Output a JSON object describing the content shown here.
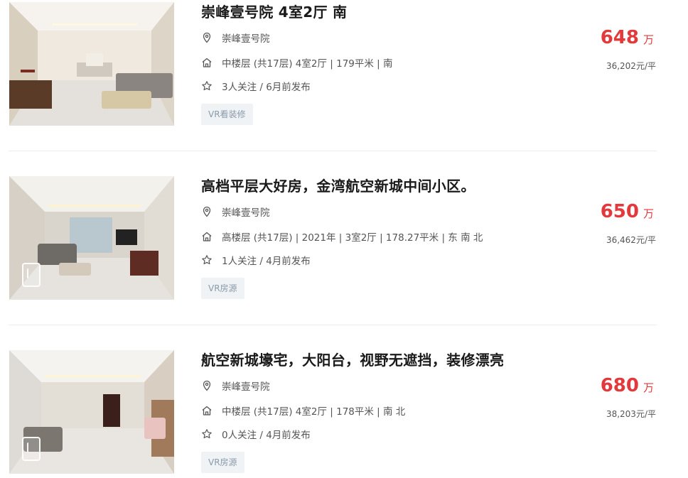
{
  "listings": [
    {
      "title": "崇峰壹号院 4室2厅 南",
      "community": "崇峰壹号院",
      "house_info": "中楼层 (共17层) 4室2厅 | 179平米 | 南",
      "follow_info": "3人关注 / 6月前发布",
      "tag": "VR看装修",
      "price": "648",
      "price_unit": "万",
      "unit_price": "36,202元/平"
    },
    {
      "title": "高档平层大好房，金湾航空新城中间小区。",
      "community": "崇峰壹号院",
      "house_info": "高楼层 (共17层) | 2021年 | 3室2厅 | 178.27平米 | 东 南 北",
      "follow_info": "1人关注 / 4月前发布",
      "tag": "VR房源",
      "price": "650",
      "price_unit": "万",
      "unit_price": "36,462元/平"
    },
    {
      "title": "航空新城壕宅，大阳台，视野无遮挡，装修漂亮",
      "community": "崇峰壹号院",
      "house_info": "中楼层 (共17层) 4室2厅 | 178平米 | 南 北",
      "follow_info": "0人关注 / 4月前发布",
      "tag": "VR房源",
      "price": "680",
      "price_unit": "万",
      "unit_price": "38,203元/平"
    }
  ],
  "icons": {
    "location": "location-pin-icon",
    "house": "house-icon",
    "follow": "star-icon",
    "vr": "vr-icon"
  },
  "colors": {
    "price": "#e4393c",
    "tag_bg": "#f0f3f6",
    "tag_text": "#8a9aa9",
    "title": "#1a1a1a"
  }
}
